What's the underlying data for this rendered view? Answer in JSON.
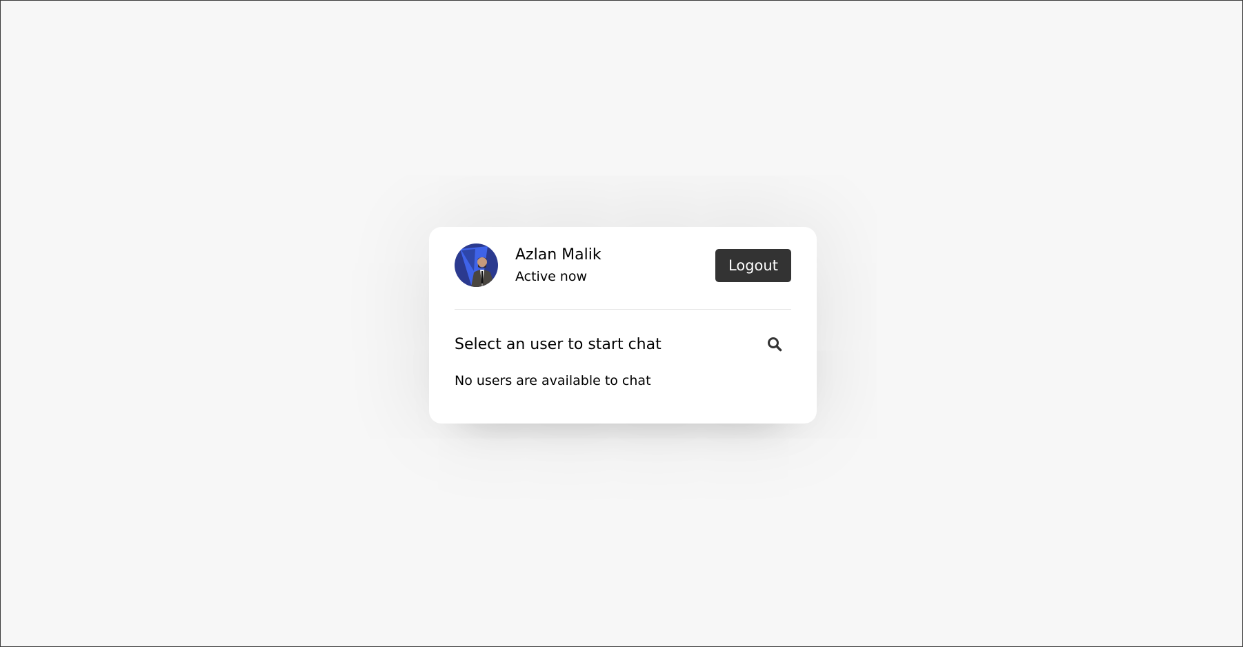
{
  "user": {
    "name": "Azlan Malik",
    "status": "Active now",
    "avatar_icon": "user-photo"
  },
  "header": {
    "logout_label": "Logout"
  },
  "search": {
    "prompt": "Select an user to start chat",
    "icon": "search-icon"
  },
  "users": {
    "empty_message": "No users are available to chat"
  },
  "colors": {
    "background": "#f7f7f7",
    "card": "#ffffff",
    "button": "#333333",
    "avatar_bg": "#2b3a8f"
  }
}
